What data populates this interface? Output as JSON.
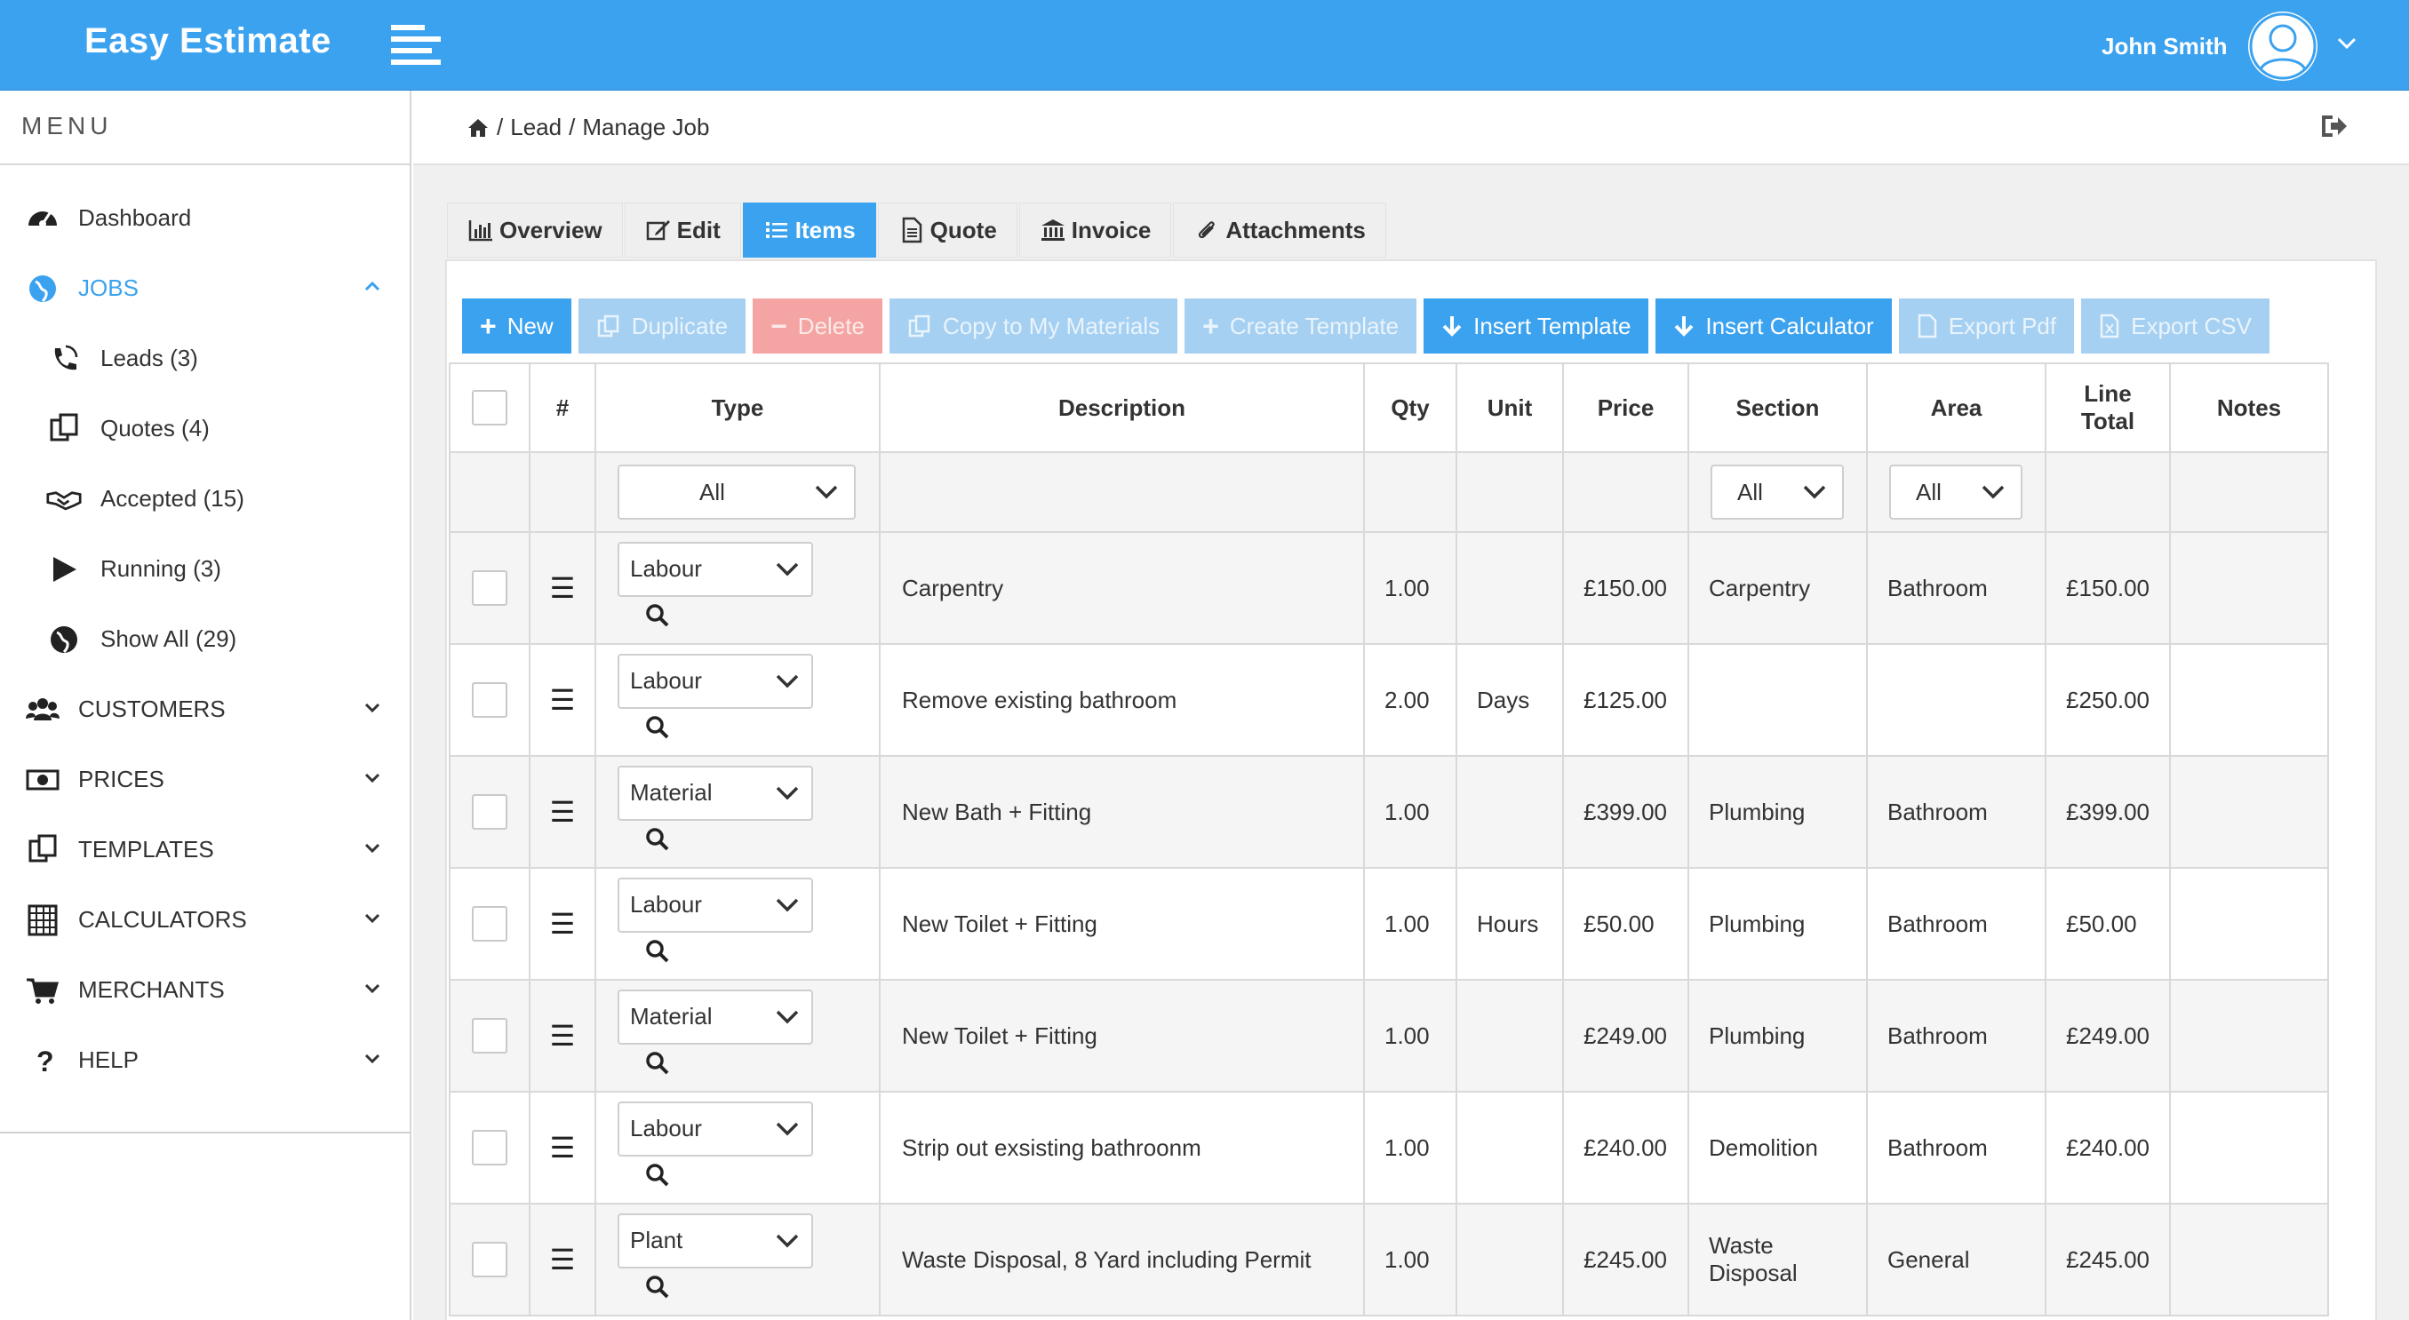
{
  "app": {
    "brand": "Easy Estimate",
    "user_name": "John Smith"
  },
  "sidebar": {
    "menu_title": "MENU",
    "items": [
      {
        "label": "Dashboard",
        "icon": "dashboard-icon"
      },
      {
        "label": "JOBS",
        "icon": "globe-icon",
        "active": true
      },
      {
        "label": "Leads (3)",
        "icon": "phone-ring-icon",
        "sub": true
      },
      {
        "label": "Quotes (4)",
        "icon": "copy-icon",
        "sub": true
      },
      {
        "label": "Accepted (15)",
        "icon": "handshake-icon",
        "sub": true
      },
      {
        "label": "Running (3)",
        "icon": "play-icon",
        "sub": true
      },
      {
        "label": "Show All (29)",
        "icon": "globe-icon",
        "sub": true
      },
      {
        "label": "CUSTOMERS",
        "icon": "users-icon"
      },
      {
        "label": "PRICES",
        "icon": "money-icon"
      },
      {
        "label": "TEMPLATES",
        "icon": "copy-icon"
      },
      {
        "label": "CALCULATORS",
        "icon": "calculator-icon"
      },
      {
        "label": "MERCHANTS",
        "icon": "cart-icon"
      },
      {
        "label": "HELP",
        "icon": "question-icon"
      }
    ]
  },
  "breadcrumb": {
    "sep1": "/",
    "lead": "Lead",
    "sep2": "/",
    "current": "Manage Job"
  },
  "tabs": [
    {
      "label": "Overview",
      "icon": "bar-chart-icon"
    },
    {
      "label": "Edit",
      "icon": "edit-icon"
    },
    {
      "label": "Items",
      "icon": "list-icon",
      "active": true
    },
    {
      "label": "Quote",
      "icon": "document-icon"
    },
    {
      "label": "Invoice",
      "icon": "bank-icon"
    },
    {
      "label": "Attachments",
      "icon": "paperclip-icon"
    }
  ],
  "toolbar": {
    "new": "New",
    "duplicate": "Duplicate",
    "delete": "Delete",
    "copy_materials": "Copy to My Materials",
    "create_template": "Create Template",
    "insert_template": "Insert Template",
    "insert_calculator": "Insert Calculator",
    "export_pdf": "Export Pdf",
    "export_csv": "Export CSV"
  },
  "table": {
    "headers": {
      "hash": "#",
      "type": "Type",
      "description": "Description",
      "qty": "Qty",
      "unit": "Unit",
      "price": "Price",
      "section": "Section",
      "area": "Area",
      "line_total_1": "Line",
      "line_total_2": "Total",
      "notes": "Notes"
    },
    "filters": {
      "type": "All",
      "section": "All",
      "area": "All"
    },
    "rows": [
      {
        "type": "Labour",
        "description": "Carpentry",
        "qty": "1.00",
        "unit": "",
        "price": "£150.00",
        "section": "Carpentry",
        "area": "Bathroom",
        "total": "£150.00"
      },
      {
        "type": "Labour",
        "description": "Remove existing bathroom",
        "qty": "2.00",
        "unit": "Days",
        "price": "£125.00",
        "section": "",
        "area": "",
        "total": "£250.00"
      },
      {
        "type": "Material",
        "description": "New Bath + Fitting",
        "qty": "1.00",
        "unit": "",
        "price": "£399.00",
        "section": "Plumbing",
        "area": "Bathroom",
        "total": "£399.00"
      },
      {
        "type": "Labour",
        "description": "New Toilet + Fitting",
        "qty": "1.00",
        "unit": "Hours",
        "price": "£50.00",
        "section": "Plumbing",
        "area": "Bathroom",
        "total": "£50.00"
      },
      {
        "type": "Material",
        "description": "New Toilet + Fitting",
        "qty": "1.00",
        "unit": "",
        "price": "£249.00",
        "section": "Plumbing",
        "area": "Bathroom",
        "total": "£249.00"
      },
      {
        "type": "Labour",
        "description": "Strip out exsisting bathroonm",
        "qty": "1.00",
        "unit": "",
        "price": "£240.00",
        "section": "Demolition",
        "area": "Bathroom",
        "total": "£240.00"
      },
      {
        "type": "Plant",
        "description": "Waste Disposal, 8 Yard including Permit",
        "qty": "1.00",
        "unit": "",
        "price": "£245.00",
        "section_1": "Waste",
        "section_2": "Disposal",
        "area": "General",
        "total": "£245.00"
      }
    ]
  },
  "colors": {
    "accent": "#3ba2ef",
    "accent_disabled": "#a6d0f1",
    "danger_disabled": "#f4a5a3"
  }
}
